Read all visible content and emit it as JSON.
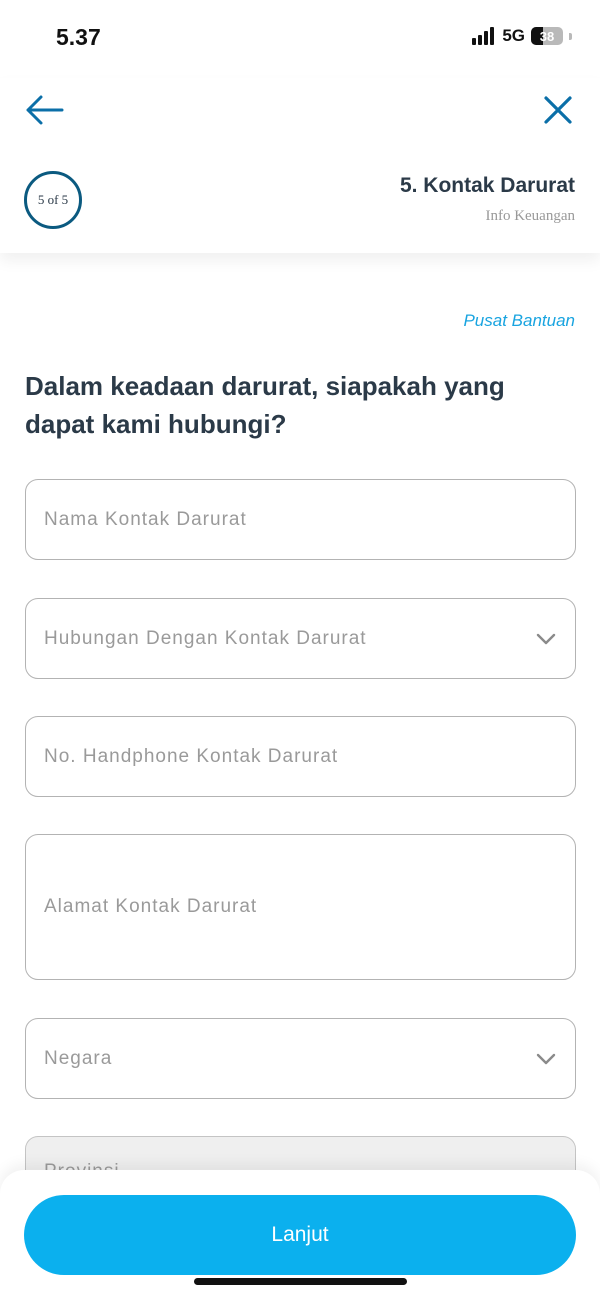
{
  "status_bar": {
    "time": "5.37",
    "network": "5G",
    "battery": "38"
  },
  "header": {
    "back_icon": "arrow-left-icon",
    "close_icon": "close-icon",
    "step_progress": "5 of 5",
    "step_title": "5. Kontak Darurat",
    "step_subtitle": "Info Keuangan",
    "accent_color": "#0b5a80"
  },
  "help_link": "Pusat Bantuan",
  "question": "Dalam keadaan darurat, siapakah yang dapat kami hubungi?",
  "form": {
    "name_placeholder": "Nama Kontak Darurat",
    "relationship_placeholder": "Hubungan Dengan Kontak Darurat",
    "phone_placeholder": "No. Handphone Kontak Darurat",
    "address_placeholder": "Alamat Kontak Darurat",
    "country_placeholder": "Negara",
    "next_field_placeholder": "Provinsi"
  },
  "footer": {
    "next_label": "Lanjut",
    "button_color": "#0bb0ee"
  }
}
